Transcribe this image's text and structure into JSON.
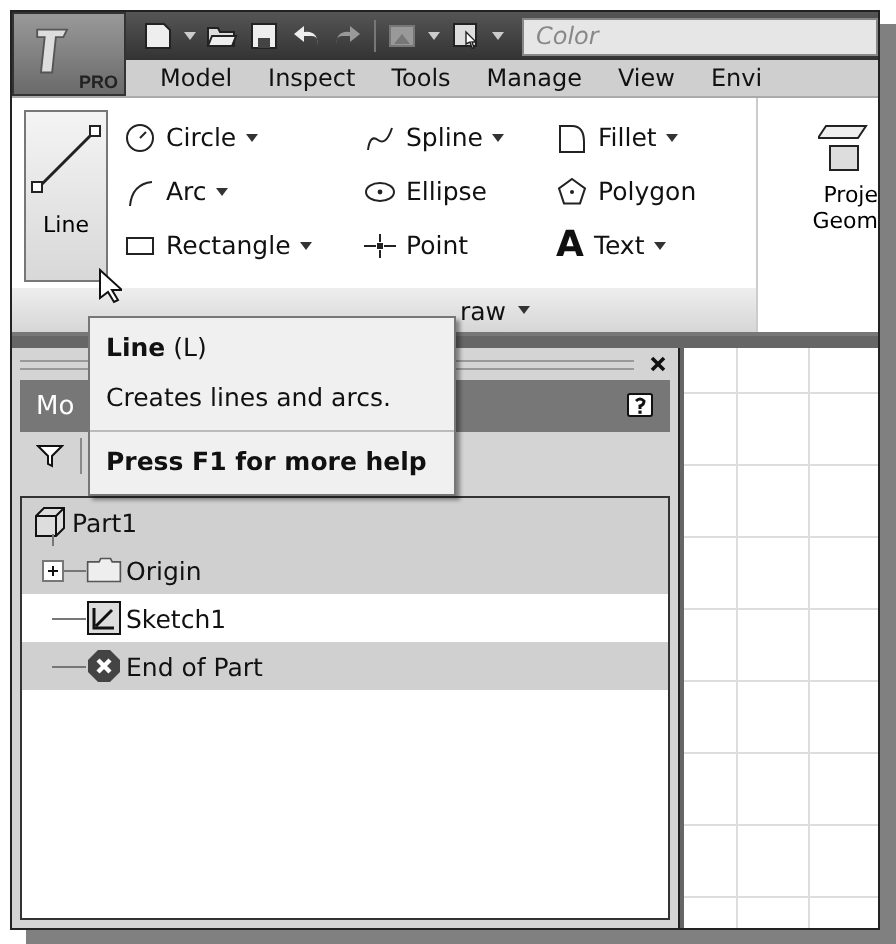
{
  "app_button": {
    "label": "PRO"
  },
  "quick_access": {
    "color_field": {
      "placeholder": "Color"
    }
  },
  "tabs": [
    {
      "label": "Model"
    },
    {
      "label": "Inspect"
    },
    {
      "label": "Tools"
    },
    {
      "label": "Manage"
    },
    {
      "label": "View"
    },
    {
      "label": "Envi"
    }
  ],
  "ribbon": {
    "line_button": {
      "label": "Line"
    },
    "tools": [
      {
        "kind": "circle",
        "label": "Circle",
        "dropdown": true
      },
      {
        "kind": "spline",
        "label": "Spline",
        "dropdown": true
      },
      {
        "kind": "fillet",
        "label": "Fillet",
        "dropdown": true
      },
      {
        "kind": "arc",
        "label": "Arc",
        "dropdown": true
      },
      {
        "kind": "ellipse",
        "label": "Ellipse",
        "dropdown": false
      },
      {
        "kind": "polygon",
        "label": "Polygon",
        "dropdown": false
      },
      {
        "kind": "rectangle",
        "label": "Rectangle",
        "dropdown": true
      },
      {
        "kind": "point",
        "label": "Point",
        "dropdown": false
      },
      {
        "kind": "text",
        "glyph": "A",
        "label": "Text",
        "dropdown": true
      }
    ],
    "panel_label": "raw",
    "cut_button": {
      "lines": [
        "Proje",
        "Geom"
      ]
    }
  },
  "tooltip": {
    "title": "Line",
    "shortcut": "(L)",
    "description": "Creates lines and arcs.",
    "help": "Press F1 for more help"
  },
  "browser": {
    "title": "Mo",
    "tree": [
      {
        "kind": "part",
        "label": "Part1",
        "highlighted": true,
        "children": [
          {
            "kind": "folder",
            "label": "Origin",
            "highlighted": true,
            "collapsed": true
          },
          {
            "kind": "sketch",
            "label": "Sketch1",
            "highlighted": false,
            "collapsed": false
          },
          {
            "kind": "end",
            "label": "End of Part",
            "highlighted": true,
            "collapsed": false
          }
        ]
      }
    ]
  }
}
